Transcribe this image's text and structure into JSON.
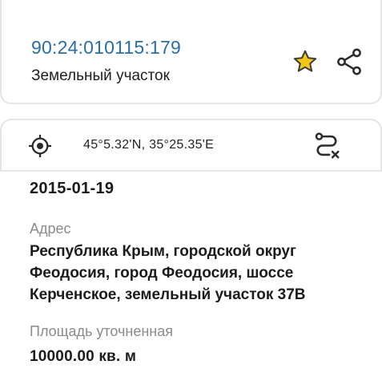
{
  "header": {
    "cadastral_number": "90:24:010115:179",
    "object_type": "Земельный участок",
    "favorite_icon": "star-icon",
    "share_icon": "share-icon"
  },
  "location": {
    "coordinates": "45°5.32'N, 35°25.35'E",
    "locate_icon": "crosshair-icon",
    "route_icon": "route-icon"
  },
  "details": {
    "date": "2015-01-19",
    "address_label": "Адрес",
    "address_value": "Республика Крым, городской округ Феодосия, город Феодосия, шоссе Керченское, земельный участок 37В",
    "area_label": "Площадь уточненная",
    "area_value": "10000.00 кв. м"
  },
  "colors": {
    "accent_blue": "#2a6ea8",
    "star_fill": "#f5c518",
    "label_gray": "#8a8a8f",
    "border": "#e4e4e7"
  }
}
